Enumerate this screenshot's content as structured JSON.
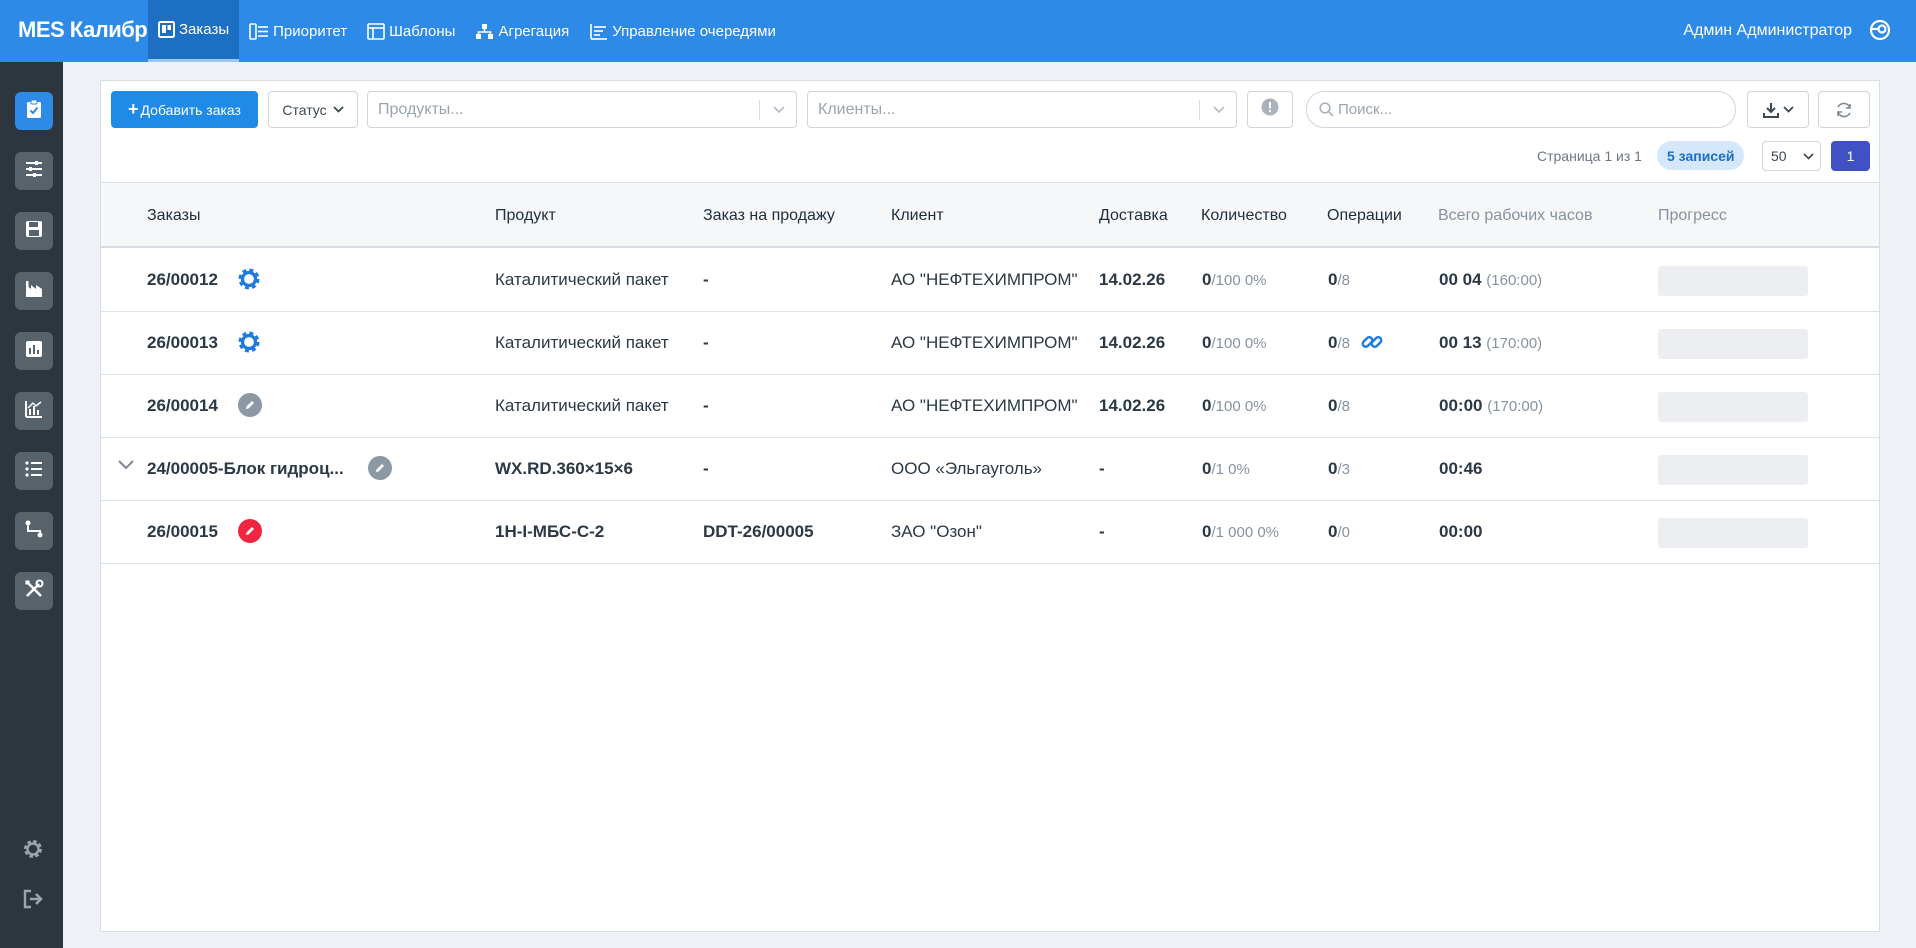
{
  "app": {
    "title": "MES Калибр",
    "user": "Админ Администратор"
  },
  "nav": [
    {
      "label": "Заказы",
      "icon": "board-icon",
      "active": true
    },
    {
      "label": "Приоритет",
      "icon": "priority-icon",
      "active": false
    },
    {
      "label": "Шаблоны",
      "icon": "template-icon",
      "active": false
    },
    {
      "label": "Агрегация",
      "icon": "aggregation-icon",
      "active": false
    },
    {
      "label": "Управление очередями",
      "icon": "queue-icon",
      "active": false
    }
  ],
  "sidebar": [
    {
      "icon": "orders-icon",
      "active": true
    },
    {
      "icon": "filter-icon",
      "active": false
    },
    {
      "icon": "save-icon",
      "active": false
    },
    {
      "icon": "factory-icon",
      "active": false
    },
    {
      "icon": "bar-chart-icon",
      "active": false
    },
    {
      "icon": "analytics-icon",
      "active": false
    },
    {
      "icon": "list-icon",
      "active": false
    },
    {
      "icon": "route-icon",
      "active": false
    },
    {
      "icon": "tools-icon",
      "active": false
    }
  ],
  "sidebar_bottom": [
    {
      "icon": "gear-icon"
    },
    {
      "icon": "logout-icon"
    }
  ],
  "toolbar": {
    "add_label": "Добавить заказ",
    "status_label": "Статус",
    "products_placeholder": "Продукты...",
    "clients_placeholder": "Клиенты...",
    "search_placeholder": "Поиск..."
  },
  "pagination": {
    "page_info": "Страница 1 из 1",
    "records": "5 записей",
    "per_page": "50",
    "current_page": "1"
  },
  "columns": {
    "orders": "Заказы",
    "product": "Продукт",
    "sales_order": "Заказ на продажу",
    "client": "Клиент",
    "delivery": "Доставка",
    "quantity": "Количество",
    "operations": "Операции",
    "total_hours": "Всего рабочих часов",
    "progress": "Прогресс"
  },
  "rows": [
    {
      "order": "26/00012",
      "status_icon": "gear-icon",
      "product": "Каталитический пакет",
      "sales_order": "-",
      "client": "АО \"НЕФТЕХИМПРОМ\"",
      "delivery": "14.02.26",
      "qty_done": "0",
      "qty_total": "/100 0%",
      "ops_done": "0",
      "ops_total": "/8",
      "link": false,
      "hours": "00 04",
      "hours_plan": "(160:00)",
      "progress": 0,
      "expandable": false
    },
    {
      "order": "26/00013",
      "status_icon": "gear-icon",
      "product": "Каталитический пакет",
      "sales_order": "-",
      "client": "АО \"НЕФТЕХИМПРОМ\"",
      "delivery": "14.02.26",
      "qty_done": "0",
      "qty_total": "/100 0%",
      "ops_done": "0",
      "ops_total": "/8",
      "link": true,
      "hours": "00 13",
      "hours_plan": "(170:00)",
      "progress": 0,
      "expandable": false
    },
    {
      "order": "26/00014",
      "status_icon": "edit-grey-icon",
      "product": "Каталитический пакет",
      "sales_order": "-",
      "client": "АО \"НЕФТЕХИМПРОМ\"",
      "delivery": "14.02.26",
      "qty_done": "0",
      "qty_total": "/100 0%",
      "ops_done": "0",
      "ops_total": "/8",
      "link": false,
      "hours": "00:00",
      "hours_plan": "(170:00)",
      "progress": 0,
      "expandable": false
    },
    {
      "order": "24/00005-Блок гидроц...",
      "status_icon": "edit-grey-icon",
      "product": "WX.RD.360×15×6",
      "sales_order": "-",
      "client": "ООО «Эльгауголь»",
      "delivery": "-",
      "qty_done": "0",
      "qty_total": "/1 0%",
      "ops_done": "0",
      "ops_total": "/3",
      "link": false,
      "hours": "00:46",
      "hours_plan": "",
      "progress": 0,
      "expandable": true
    },
    {
      "order": "26/00015",
      "status_icon": "edit-red-icon",
      "product": "1Н-I-МБС-С-2",
      "sales_order": "DDT-26/00005",
      "client": "ЗАО \"Озон\"",
      "delivery": "-",
      "qty_done": "0",
      "qty_total": "/1 000 0%",
      "ops_done": "0",
      "ops_total": "/0",
      "link": false,
      "hours": "00:00",
      "hours_plan": "",
      "progress": 0,
      "expandable": false
    }
  ],
  "colors": {
    "primary": "#2d8ae6",
    "sidebar": "#2d363e",
    "danger": "#f0253f",
    "page_button": "#3f51c4"
  }
}
